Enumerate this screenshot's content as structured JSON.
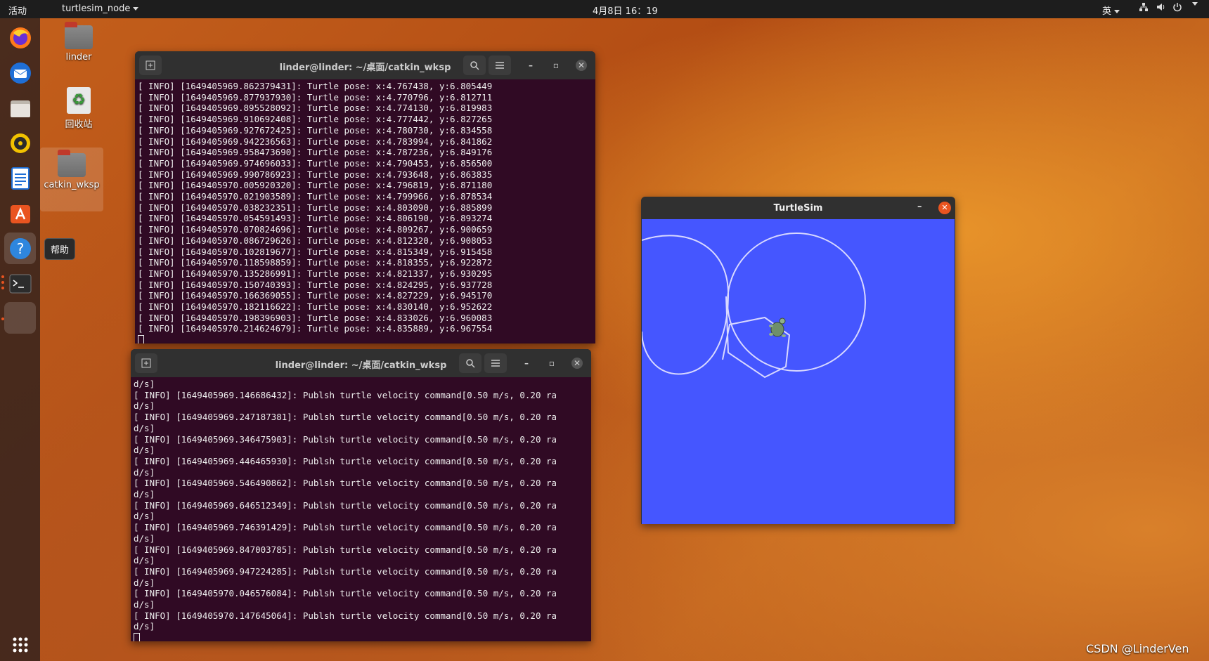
{
  "topbar": {
    "activities": "活动",
    "app_menu": "turtlesim_node",
    "clock": "4月8日  16：19",
    "input_method": "英"
  },
  "dock": {
    "items": [
      "firefox-icon",
      "thunderbird-icon",
      "files-icon",
      "rhythmbox-icon",
      "writer-icon",
      "software-icon",
      "help-icon",
      "terminal-icon",
      "blank-icon",
      "show-apps-icon"
    ],
    "tooltip": "帮助"
  },
  "desktop": {
    "icons": [
      {
        "label": "linder"
      },
      {
        "label": "回收站"
      },
      {
        "label": "catkin_wksp"
      }
    ]
  },
  "terminal1": {
    "title": "linder@linder: ~/桌面/catkin_wksp",
    "lines": [
      "[ INFO] [1649405969.862379431]: Turtle pose: x:4.767438, y:6.805449",
      "[ INFO] [1649405969.877937930]: Turtle pose: x:4.770796, y:6.812711",
      "[ INFO] [1649405969.895528092]: Turtle pose: x:4.774130, y:6.819983",
      "[ INFO] [1649405969.910692408]: Turtle pose: x:4.777442, y:6.827265",
      "[ INFO] [1649405969.927672425]: Turtle pose: x:4.780730, y:6.834558",
      "[ INFO] [1649405969.942236563]: Turtle pose: x:4.783994, y:6.841862",
      "[ INFO] [1649405969.958473690]: Turtle pose: x:4.787236, y:6.849176",
      "[ INFO] [1649405969.974696033]: Turtle pose: x:4.790453, y:6.856500",
      "[ INFO] [1649405969.990786923]: Turtle pose: x:4.793648, y:6.863835",
      "[ INFO] [1649405970.005920320]: Turtle pose: x:4.796819, y:6.871180",
      "[ INFO] [1649405970.021903589]: Turtle pose: x:4.799966, y:6.878534",
      "[ INFO] [1649405970.038232351]: Turtle pose: x:4.803090, y:6.885899",
      "[ INFO] [1649405970.054591493]: Turtle pose: x:4.806190, y:6.893274",
      "[ INFO] [1649405970.070824696]: Turtle pose: x:4.809267, y:6.900659",
      "[ INFO] [1649405970.086729626]: Turtle pose: x:4.812320, y:6.908053",
      "[ INFO] [1649405970.102819677]: Turtle pose: x:4.815349, y:6.915458",
      "[ INFO] [1649405970.118598859]: Turtle pose: x:4.818355, y:6.922872",
      "[ INFO] [1649405970.135286991]: Turtle pose: x:4.821337, y:6.930295",
      "[ INFO] [1649405970.150740393]: Turtle pose: x:4.824295, y:6.937728",
      "[ INFO] [1649405970.166369055]: Turtle pose: x:4.827229, y:6.945170",
      "[ INFO] [1649405970.182116622]: Turtle pose: x:4.830140, y:6.952622",
      "[ INFO] [1649405970.198396903]: Turtle pose: x:4.833026, y:6.960083",
      "[ INFO] [1649405970.214624679]: Turtle pose: x:4.835889, y:6.967554"
    ]
  },
  "terminal2": {
    "title": "linder@linder: ~/桌面/catkin_wksp",
    "lines": [
      "d/s]",
      "[ INFO] [1649405969.146686432]: Publsh turtle velocity command[0.50 m/s, 0.20 ra",
      "d/s]",
      "[ INFO] [1649405969.247187381]: Publsh turtle velocity command[0.50 m/s, 0.20 ra",
      "d/s]",
      "[ INFO] [1649405969.346475903]: Publsh turtle velocity command[0.50 m/s, 0.20 ra",
      "d/s]",
      "[ INFO] [1649405969.446465930]: Publsh turtle velocity command[0.50 m/s, 0.20 ra",
      "d/s]",
      "[ INFO] [1649405969.546490862]: Publsh turtle velocity command[0.50 m/s, 0.20 ra",
      "d/s]",
      "[ INFO] [1649405969.646512349]: Publsh turtle velocity command[0.50 m/s, 0.20 ra",
      "d/s]",
      "[ INFO] [1649405969.746391429]: Publsh turtle velocity command[0.50 m/s, 0.20 ra",
      "d/s]",
      "[ INFO] [1649405969.847003785]: Publsh turtle velocity command[0.50 m/s, 0.20 ra",
      "d/s]",
      "[ INFO] [1649405969.947224285]: Publsh turtle velocity command[0.50 m/s, 0.20 ra",
      "d/s]",
      "[ INFO] [1649405970.046576084]: Publsh turtle velocity command[0.50 m/s, 0.20 ra",
      "d/s]",
      "[ INFO] [1649405970.147645064]: Publsh turtle velocity command[0.50 m/s, 0.20 ra",
      "d/s]"
    ]
  },
  "turtlesim": {
    "title": "TurtleSim",
    "background_color": "#4556ff",
    "trail_color": "#d8d8ff"
  },
  "watermark": "CSDN @LinderVen"
}
